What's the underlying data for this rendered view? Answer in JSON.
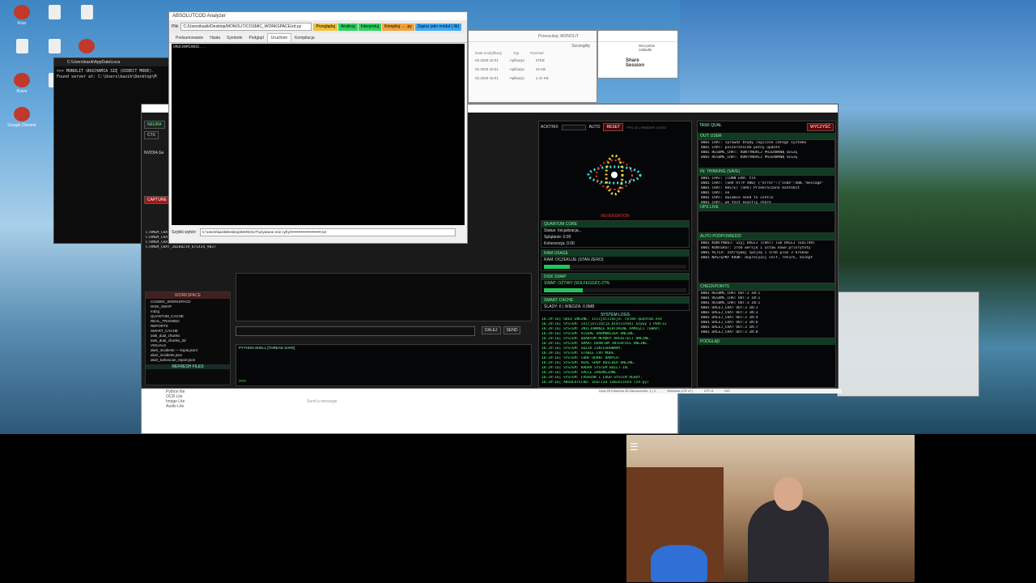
{
  "desktop_icons_left": [
    {
      "label": "Kosz",
      "kind": "app"
    },
    {
      "label": "",
      "kind": "doc"
    },
    {
      "label": "",
      "kind": "doc"
    },
    {
      "label": "",
      "kind": "doc"
    },
    {
      "label": "",
      "kind": "doc"
    },
    {
      "label": "",
      "kind": "app"
    },
    {
      "label": "Brave",
      "kind": "app"
    },
    {
      "label": "",
      "kind": "doc"
    },
    {
      "label": "",
      "kind": "doc"
    },
    {
      "label": "Google Chrome",
      "kind": "app"
    }
  ],
  "console": {
    "title": "C:\\Users\\kazik\\AppData\\Loca",
    "lines": [
      ">>> MONOLIT URUCHAMIA SIĘ (DIRECT MODE).",
      "Found server at: C:\\Users\\kazik\\Desktop\\M"
    ]
  },
  "analyzer": {
    "title": "ABSOLUTCOD Analyzer",
    "file_label": "Plik:",
    "file_path": "C:/Users/kazik/Desktop/MONOLIT/COSMIC_WORKSPACE/zd.py",
    "buttons": [
      "Przeglądaj",
      "Analizuj",
      "Interpretuj",
      "Kompiluj → .py",
      "Zapisz jako moduł (.lib)"
    ],
    "button_colors": [
      "#f0c23c",
      "#2fd060",
      "#2fd060",
      "#f0a23c",
      "#3fa9f5"
    ],
    "tabs": [
      "Podsumowanie",
      "Hasła",
      "Symbole",
      "Podgląd",
      "Uruchom",
      "Kompilacja"
    ],
    "active_tab": 4,
    "output_text": "URUCHAMIANIE...",
    "quick_label": "Szybki wybór:",
    "quick_value": "C:\\Users\\kazik\\Desktop\\MONOLIT\\ożywione nne cyfry\\••••••••••••••••••••••••.txt"
  },
  "monolit": {
    "left_header": "NEURA",
    "ctx_label": "CTX",
    "gpu": "NVIDIA Ge",
    "capture": "CAPTURE",
    "capture_list": [
      "CTXMEM_CHAT_20260219_0",
      "CTXMEM_CHAT_20260219_042534_3600",
      "CTXMEM_CHAT_20260219_045227_1900",
      "CTXMEM_CHAT_20260219_071434_9037"
    ],
    "workspace_header": "WORKSPACE",
    "tree": [
      "COSMIC_WORKSPACE",
      "DISK_SWAP",
      "mdzg",
      "QUANTUM_CACHE",
      "REAL_TRAINING",
      "REPORTS",
      "SMART_CACHE",
      "task_dual_chunks",
      "task_dual_chunks_3d",
      "VISUALS",
      "alwir_incidents — kopia.jsonl",
      "alwir_incidents.json",
      "alwir_turboscan_report.json"
    ],
    "refresh": "REFRESH FILES",
    "shell_header": "PYTHON SHELL [THREAD SAFE]",
    "shell_prompt": ">>>",
    "dalej": "DALEJ",
    "send": "SEND",
    "toolbar_tags": [
      "BANK",
      "RESTORE",
      "PY (module)"
    ],
    "acktrix": "ACKTRIX",
    "auto": "AUTO",
    "reset": "RESET",
    "fps": "FPS: 33 | RENDER: GOOD",
    "sim_caption": "REVERSATION",
    "quantum": {
      "title": "QUANTUM CORE",
      "status": "Status: Inicjalizacja...",
      "splatanie": "Splątanie: 0.00",
      "koherencja": "Koherencja: 0.00"
    },
    "ram": {
      "title": "RAM USAGE",
      "line": "RAM: OCZEKUJE (STAN ZERO)",
      "fill": 0.18
    },
    "swap": {
      "title": "DISK SWAP",
      "line": "SWAP: OŻYWY (SOLFEGGIO) 27%",
      "fill": 0.27
    },
    "cache": {
      "title": "SMART CACHE",
      "line": "ŚLADY: 6 | WIEDZA: 0.0MB"
    },
    "logs_header": "SYSTEM LOGS",
    "logs": [
      "16:29:16| GOLD ENGINE: Inicjalizacja: cosmo-quantum.exe",
      "16:29:16| SYSTEM: Inicjalizacja biblioteki ożywy I PORTIZ",
      "16:29:16| SYSTEM: INICJOWANIE WIRTUALNE PAMIĘCI (SWAP)",
      "16:29:16| SYSTEM: VISUAL HARMONIZER ONLINE.",
      "16:29:16| SYSTEM: QUANTUM MEMORY ARCHITECT ONLINE.",
      "16:29:16| SYSTEM: SMART QUANTUM INTERFACE ONLINE.",
      "16:29:16| SYSTEM: GUZIK ZINTEGROWANY.",
      "16:29:16| SYSTEM: STABLE CPU MODE.",
      "16:29:16| SYSTEM: CORE QUANT DANYCH.",
      "16:29:16| SYSTEM: REAL SHOP BUILDER ONLINE.",
      "16:29:16| SYSTEM: RADAR SYSTEM BUILT-IN.",
      "16:29:16| SYSTEM: SPECE ZAKOŃCZONE",
      "16:29:16| SYSTEM: FASHION I LOGO SYSTEM READY.",
      "16:29:16| ABSOLUTECOD: analiza zakończona (zd.py)"
    ],
    "task_header": "TASK QUAL",
    "clear": "WYCZYŚĆ",
    "out_header": "OUT: USER",
    "out_lines": [
      "0001 CHAT: sprawdź błędy logiczne całego systemu",
      "0001 CHAT: poszerzeniem pełny update",
      "0001 RESUME_CHAT: KONTYNUACJ PRZERWANĄ SESJĘ",
      "0001 RESUME_CHAT: KONTYNUACJ PRZERWANĄ SESJĘ"
    ],
    "thinking_header": "IN: THINKING (SAVE)",
    "thinking_lines": [
      "0001 CHAT: [CONN ERR: tie",
      "0001 CHAT: [SRV HTTP 400] {\"error\":{\"code\":400,\"message\"",
      "0001 CHAT: HOSTE) [SRV] Przekroczono kontekst",
      "0001 CHAT: ok",
      "0001 CHAT: awiamie need to contin",
      "0001 CHAT: we test exactly share"
    ],
    "ops_header": "OPS LIVE",
    "auto_header": "AUTO PODPOWIEDZI",
    "auto_lines": [
      "0001 KONTYNUUJ: użyj DALEJ (CHAT) lub DALEJ (EDITOR)",
      "0001 KONTEKST: zrób wersję 1 ustaw nowe priorytety",
      "0001 PĘTLA: zatrzymaj spójną i zrób plan 3 kroków",
      "0001 NASTĘPNY KROK: doprecyzuj self, return, except"
    ],
    "check_header": "CHECKPOINTS",
    "check_lines": [
      "0001 RESUME_CHAT OUT:2 IN:1",
      "0001 RESUME_CHAT OUT:3 IN:1",
      "0001 RESUME_CHAT OUT:3 IN:1",
      "0001 DALEJ_CHAT OUT:3 IN:2",
      "0001 DALEJ_CHAT OUT:3 IN:3",
      "0001 DALEJ_CHAT OUT:3 IN:4",
      "0001 DALEJ_CHAT OUT:3 IN:6",
      "0001 DALEJ_CHAT OUT:3 IN:7",
      "0001 DALEJ_CHAT OUT:3 IN:8"
    ],
    "preview_header": "PODGLĄD"
  },
  "explorer": {
    "search": "Przeszukaj: MONOLIT",
    "details": "Szczegóły",
    "col_mod": "Data modyfikacji",
    "col_type": "Typ",
    "col_size": "Rozmiar",
    "rows": [
      {
        "date": "02.2025 16:01",
        "type": "Aplikacja",
        "size": "27KB"
      },
      {
        "date": "02.2025 16:01",
        "type": "Aplikacja",
        "size": "16 KB"
      },
      {
        "date": "02.2025 16:01",
        "type": "Aplikacja",
        "size": "1.41 KB"
      }
    ],
    "status": [
      "Elementy: 73",
      "1 zaznaczony element 1,33 MB"
    ]
  },
  "browser": {
    "share": "Share Session",
    "all_bookmarks": "Wszystkie zakładki"
  },
  "chat_window": {
    "placeholder": "Send a message",
    "attachments": [
      "Python file",
      "OCR Lite",
      "Image Lite",
      "Audio Lite"
    ]
  },
  "statusbar": {
    "left": "Linia 29 Kolumna 35 Zaznaczenie: 1 | 1",
    "mid": "Windows (CR LF)",
    "enc": "UTF-8",
    "ins": "INS"
  }
}
